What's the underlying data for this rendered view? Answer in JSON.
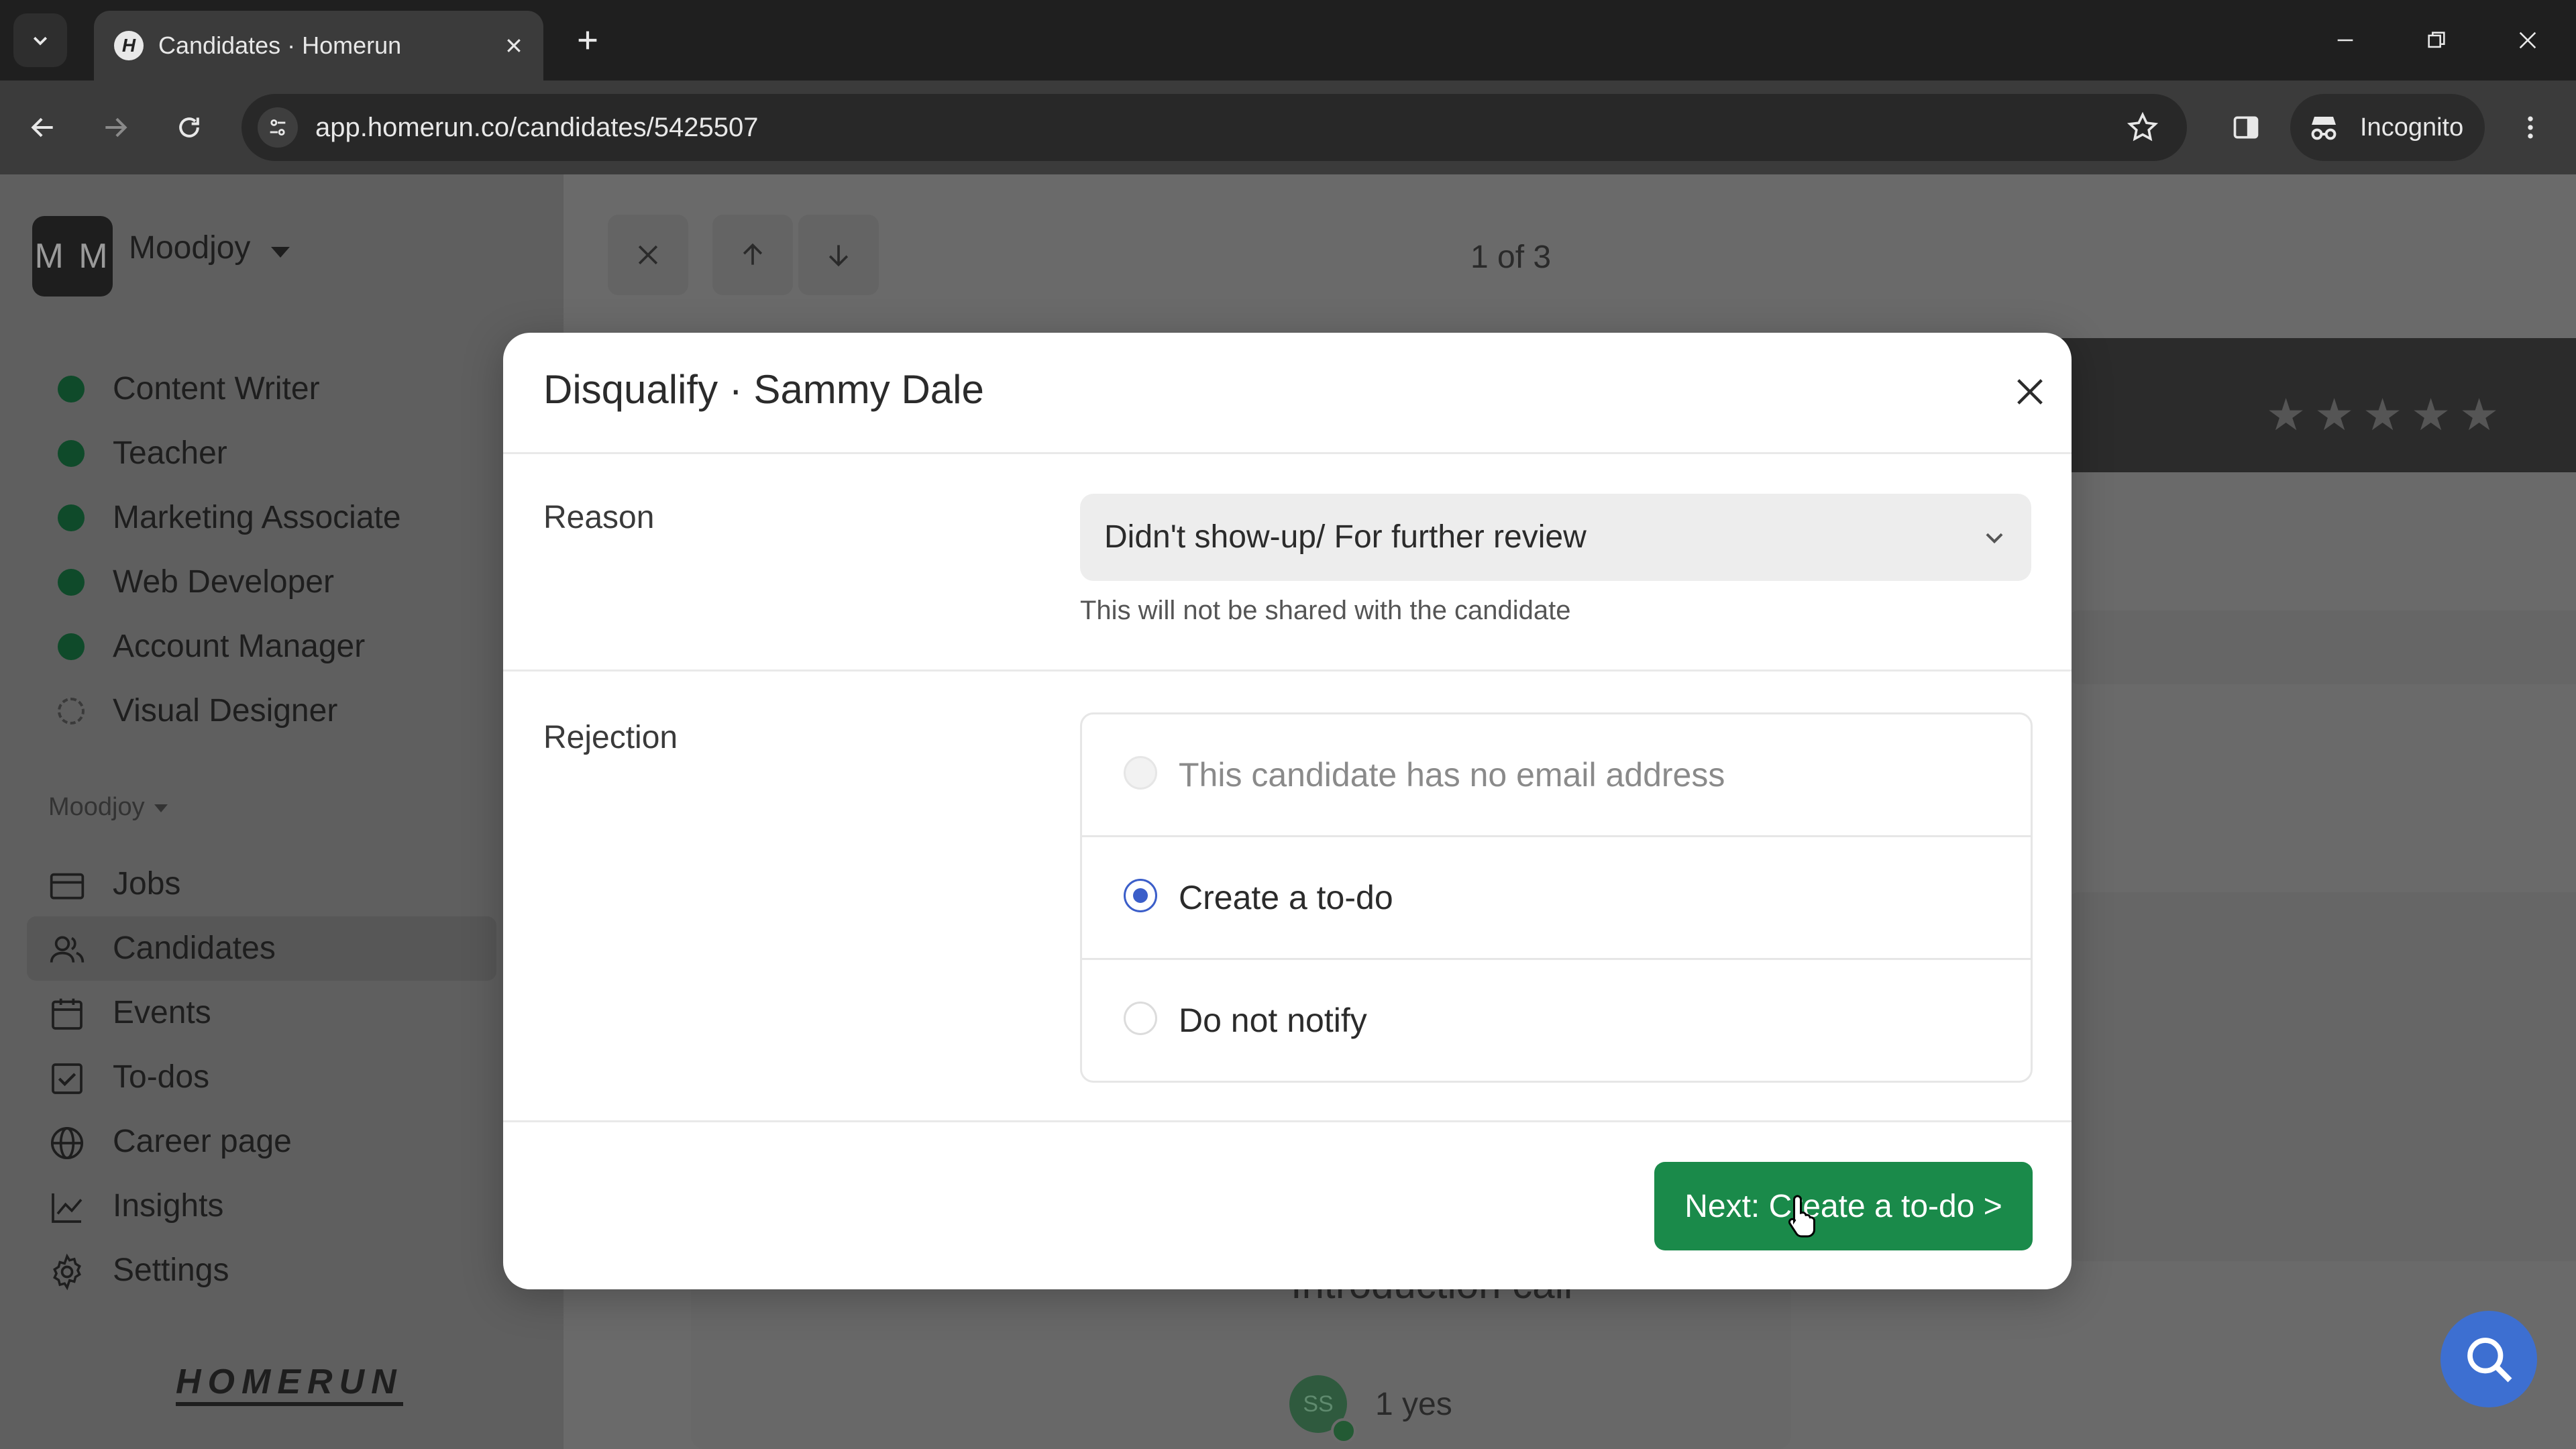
{
  "browser": {
    "tab_title": "Candidates · Homerun",
    "favicon_letter": "H",
    "url": "app.homerun.co/candidates/5425507",
    "incognito_label": "Incognito"
  },
  "sidebar": {
    "workspace_initials": "M M",
    "workspace_name": "Moodjoy",
    "jobs": [
      {
        "label": "Content Writer"
      },
      {
        "label": "Teacher"
      },
      {
        "label": "Marketing Associate"
      },
      {
        "label": "Web Developer"
      },
      {
        "label": "Account Manager"
      },
      {
        "label": "Visual Designer"
      }
    ],
    "section_label": "Moodjoy",
    "nav": [
      {
        "label": "Jobs",
        "icon": "briefcase-icon"
      },
      {
        "label": "Candidates",
        "icon": "users-icon"
      },
      {
        "label": "Events",
        "icon": "calendar-icon"
      },
      {
        "label": "To-dos",
        "icon": "checkbox-icon"
      },
      {
        "label": "Career page",
        "icon": "globe-icon"
      },
      {
        "label": "Insights",
        "icon": "chart-line-icon"
      },
      {
        "label": "Settings",
        "icon": "gear-icon"
      }
    ],
    "logo_text": "HOMERUN"
  },
  "main": {
    "pager_text": "1 of 3",
    "background_title": "Introduction call",
    "background_avatar_initials": "SS",
    "background_value": "1 yes"
  },
  "modal": {
    "title": "Disqualify · Sammy Dale",
    "reason_label": "Reason",
    "reason_value": "Didn't show-up/ For further review",
    "reason_helper": "This will not be shared with the candidate",
    "rejection_label": "Rejection",
    "options": [
      {
        "label": "This candidate has no email address",
        "state": "disabled"
      },
      {
        "label": "Create a to-do",
        "state": "checked"
      },
      {
        "label": "Do not notify",
        "state": "unchecked"
      }
    ],
    "next_button": "Next: Create a to-do >"
  },
  "colors": {
    "primary_green": "#1a8a4a",
    "radio_blue": "#3b5ec9",
    "search_fab_blue": "#3d6fd1"
  }
}
